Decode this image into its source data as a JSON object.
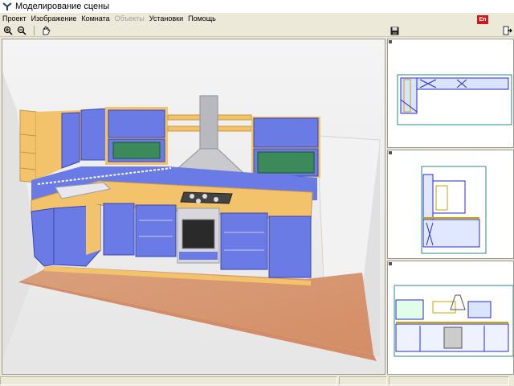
{
  "window": {
    "title": "Моделирование сцены"
  },
  "menu": [
    {
      "label": "Проект",
      "enabled": true
    },
    {
      "label": "Изображение",
      "enabled": true
    },
    {
      "label": "Комната",
      "enabled": true
    },
    {
      "label": "Объекты",
      "enabled": false
    },
    {
      "label": "Установки",
      "enabled": true
    },
    {
      "label": "Помощь",
      "enabled": true
    }
  ],
  "language_badge": "En",
  "toolbar": {
    "icons": [
      "zoom-in-icon",
      "zoom-out-icon",
      "hand-pan-icon",
      "save-icon",
      "exit-icon"
    ]
  },
  "scene": {
    "colors": {
      "cabinet": "#6b7be6",
      "wood": "#f2c36b",
      "floor": "#d99a75",
      "wall": "#f0f0f0",
      "glass": "#3c8a5a",
      "hood": "#c8c8cc"
    }
  },
  "views": [
    {
      "name": "top-view"
    },
    {
      "name": "side-view"
    },
    {
      "name": "front-view"
    }
  ]
}
